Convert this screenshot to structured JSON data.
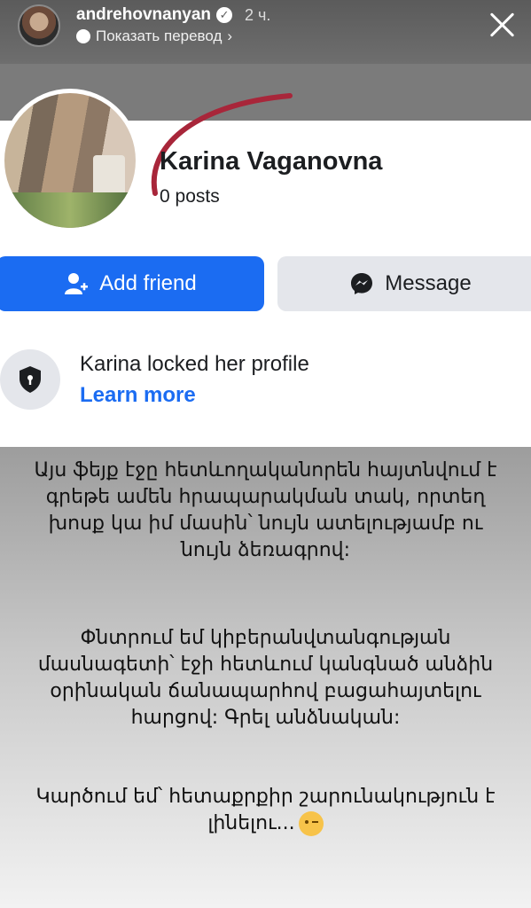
{
  "story": {
    "username": "andrehovnanyan",
    "time": "2 ч.",
    "translate_label": "Показать перевод",
    "translate_chevron": "›"
  },
  "profile": {
    "name": "Karina Vaganovna",
    "posts": "0 posts",
    "add_friend_label": "Add friend",
    "message_label": "Message",
    "locked_text": "Karina locked her profile",
    "learn_more": "Learn more"
  },
  "text": {
    "p1": "Այս ֆեյք էջը հետևողականորեն հայտնվում է գրեթե ամեն հրապարակման տակ, որտեղ խոսք կա իմ մասին՝ նույն ատելությամբ ու նույն ձեռագրով:",
    "p2": "Փնտրում եմ կիբերանվտանգության մասնագետի՝ էջի հետևում կանգնած անձին օրինական ճանապարհով բացահայտելու հարցով: Գրել անձնական:",
    "p3": "Կարծում եմ՝ հետաքրքիր շարունակություն է լինելու..."
  },
  "colors": {
    "fb_blue": "#1b6cf2",
    "arc_red": "#a8263a"
  },
  "icons": {
    "verified": "verified-icon",
    "close": "close-icon",
    "add_friend": "add-friend-icon",
    "messenger": "messenger-icon",
    "lock": "shield-lock-icon",
    "wink": "wink-emoji-icon"
  }
}
